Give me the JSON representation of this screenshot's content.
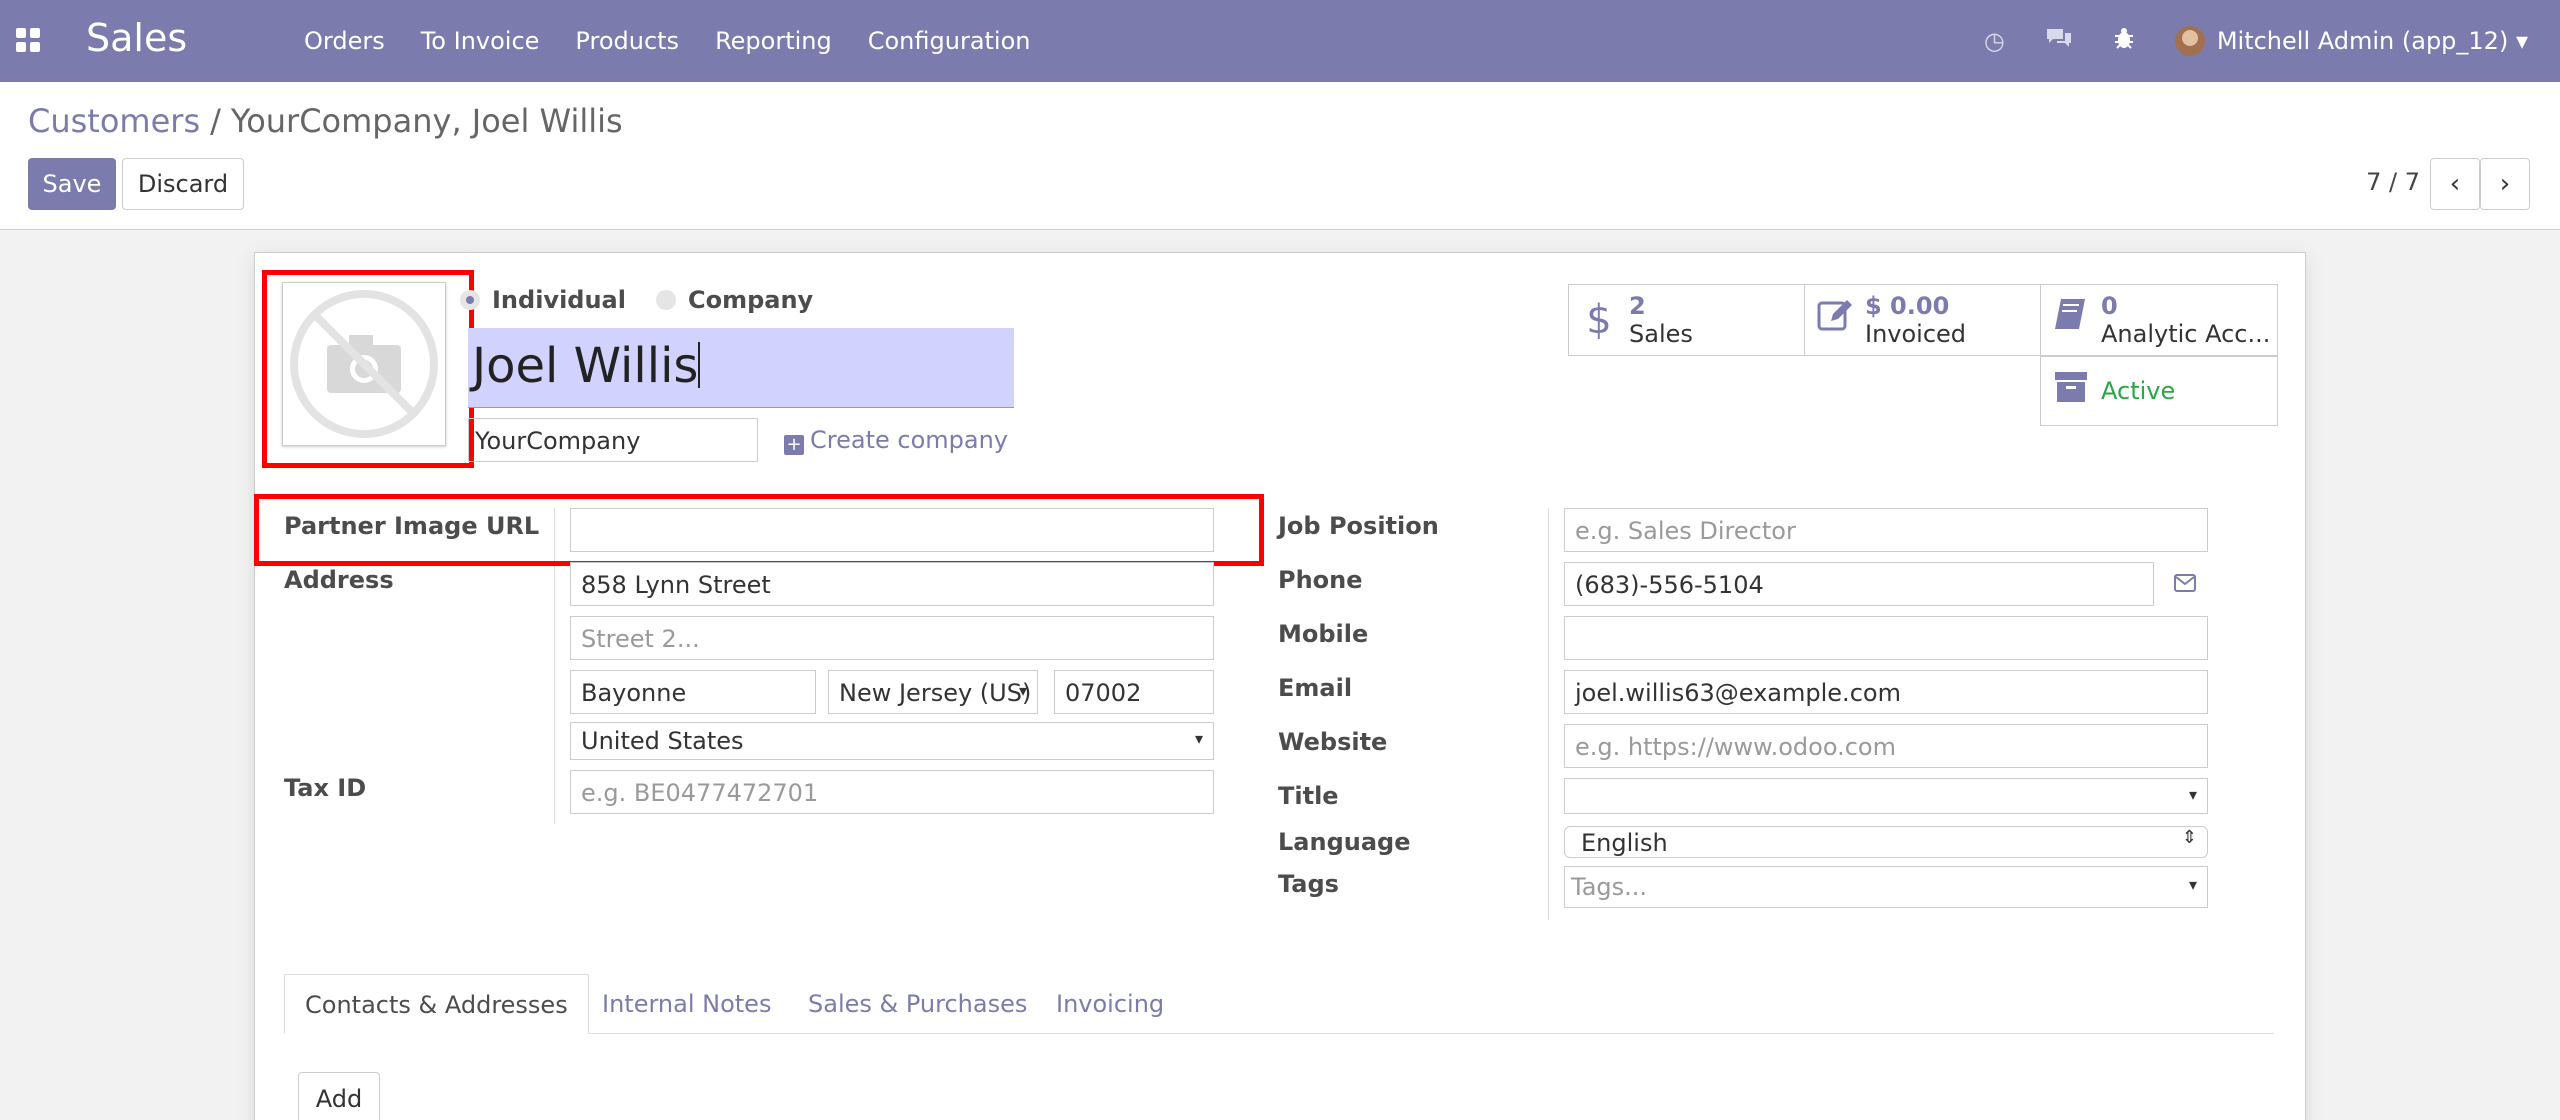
{
  "navbar": {
    "app_name": "Sales",
    "menu": [
      "Orders",
      "To Invoice",
      "Products",
      "Reporting",
      "Configuration"
    ],
    "icons": [
      "clock-icon",
      "chat-icon",
      "bug-icon"
    ],
    "user": "Mitchell Admin (app_12)"
  },
  "breadcrumb": {
    "parent": "Customers",
    "separator": "/",
    "current": "YourCompany, Joel Willis"
  },
  "actions": {
    "save": "Save",
    "discard": "Discard"
  },
  "pager": {
    "text": "7 / 7",
    "prev": "‹",
    "next": "›"
  },
  "form": {
    "type_options": {
      "individual": "Individual",
      "company": "Company",
      "selected": "Individual"
    },
    "name": "Joel Willis",
    "company": "YourCompany",
    "create_company": "Create company",
    "stats": {
      "sales": {
        "value": "2",
        "label": "Sales"
      },
      "invoiced": {
        "value": "$ 0.00",
        "label": "Invoiced"
      },
      "analytic": {
        "value": "0",
        "label": "Analytic Acc..."
      },
      "active": {
        "label": "Active"
      }
    },
    "left": {
      "image_url_label": "Partner Image URL",
      "image_url_value": "",
      "address_label": "Address",
      "street": "858 Lynn Street",
      "street2_placeholder": "Street 2...",
      "city": "Bayonne",
      "state": "New Jersey (US)",
      "zip": "07002",
      "country": "United States",
      "taxid_label": "Tax ID",
      "taxid_placeholder": "e.g. BE0477472701"
    },
    "right": {
      "job_label": "Job Position",
      "job_placeholder": "e.g. Sales Director",
      "phone_label": "Phone",
      "phone": "(683)-556-5104",
      "mobile_label": "Mobile",
      "mobile": "",
      "email_label": "Email",
      "email": "joel.willis63@example.com",
      "website_label": "Website",
      "website_placeholder": "e.g. https://www.odoo.com",
      "title_label": "Title",
      "title": "",
      "language_label": "Language",
      "language": "English",
      "tags_label": "Tags",
      "tags_placeholder": "Tags..."
    }
  },
  "tabs": [
    "Contacts & Addresses",
    "Internal Notes",
    "Sales & Purchases",
    "Invoicing"
  ],
  "add_button": "Add",
  "colors": {
    "brand": "#7c7bad",
    "active": "#28a745",
    "highlight": "#ff0000"
  }
}
